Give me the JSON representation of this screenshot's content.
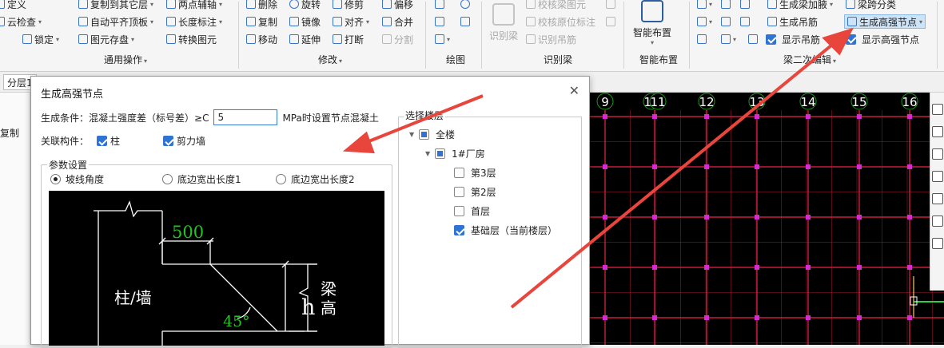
{
  "ribbon": {
    "col1": {
      "define": "定义",
      "check": "云检查",
      "lock": "锁定"
    },
    "col2": {
      "copy_to_floor": "复制到其它层",
      "auto_align_top": "自动平齐顶板",
      "store": "图元存盘"
    },
    "col3": {
      "axis_aux": "两点辅轴",
      "length_mark": "长度标注",
      "convert": "转换图元"
    },
    "group_general": "通用操作",
    "modify": {
      "delete": "删除",
      "rotate": "旋转",
      "trim": "修剪",
      "offset": "偏移",
      "copy": "复制",
      "mirror": "镜像",
      "align": "对齐",
      "merge": "合并",
      "move": "移动",
      "extend": "延伸",
      "break": "打断",
      "split": "分割"
    },
    "group_modify": "修改",
    "group_draw": "绘图",
    "recognize": {
      "beam_button": "识别梁",
      "check_beam": "校核梁图元",
      "check_origin": "校核原位标注",
      "hanger": "识别吊筋"
    },
    "group_recognize": "识别梁",
    "smart": {
      "layout": "智能布置"
    },
    "group_smart": "智能布置",
    "beam2": {
      "gen_haunch": "生成梁加腋",
      "span_class": "梁跨分类",
      "gen_hanger": "生成吊筋",
      "gen_hs_node": "生成高强节点",
      "show_hanger": "显示吊筋",
      "show_hs_node": "显示高强节点"
    },
    "group_beam2": "梁二次编辑"
  },
  "toolbar2": {
    "floor_label": "分层1"
  },
  "left_panel": {
    "copy": "复制"
  },
  "dialog": {
    "title": "生成高强节点",
    "cond_label": "生成条件：",
    "cond_text": "混凝土强度差（标号差）≥C",
    "cond_value": "5",
    "cond_suffix": "MPa时设置节点混凝土",
    "related_label": "关联构件：",
    "chk_column": "柱",
    "chk_shear_wall": "剪力墙",
    "param_legend": "参数设置",
    "radio_slope": "坡线角度",
    "radio_bottom1": "底边宽出长度1",
    "radio_bottom2": "底边宽出长度2",
    "preview": {
      "dim": "500",
      "angle": "45°",
      "col_wall": "柱/墙",
      "h": "h",
      "beam": "梁",
      "height": "高"
    },
    "floor_legend": "选择楼层",
    "tree": {
      "all": "全楼",
      "building": "1#厂房",
      "f3": "第3层",
      "f2": "第2层",
      "f1": "首层",
      "base": "基础层（当前楼层）"
    }
  },
  "canvas": {
    "axis_labels": [
      "9",
      "10",
      "11",
      "12",
      "13",
      "14",
      "15",
      "16"
    ]
  },
  "colors": {
    "canvas_bg": "#000000",
    "grid": "#c81e3c",
    "node": "#d42bd4",
    "arrow": "#e8453c",
    "accent": "#2f73d3"
  }
}
